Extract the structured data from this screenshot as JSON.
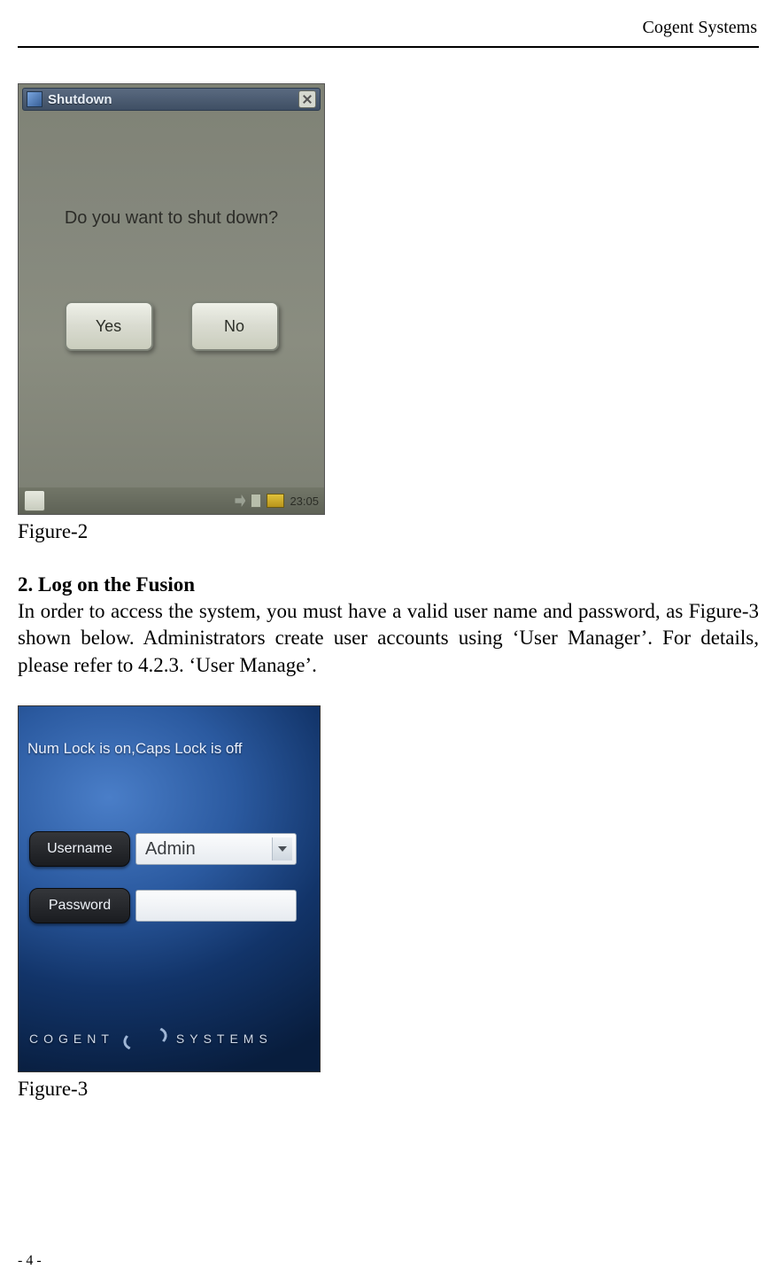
{
  "header": {
    "org": "Cogent Systems"
  },
  "figure2": {
    "caption": "Figure-2",
    "dialog": {
      "title": "Shutdown",
      "prompt": "Do you want to shut down?",
      "yes": "Yes",
      "no": "No"
    },
    "clock": "23:05"
  },
  "section": {
    "heading": "2. Log on the Fusion",
    "paragraph": "In order to access the system, you must have a valid user name and password, as Figure-3 shown below. Administrators create user accounts using ‘User Manager’. For details, please refer to 4.2.3. ‘User Manage’."
  },
  "figure3": {
    "caption": "Figure-3",
    "lock_status": "Num Lock is on,Caps Lock is off",
    "username_label": "Username",
    "username_value": "Admin",
    "password_label": "Password",
    "password_value": "",
    "brand_left": "COGENT",
    "brand_right": "SYSTEMS"
  },
  "footer": {
    "page": "- 4 -"
  }
}
